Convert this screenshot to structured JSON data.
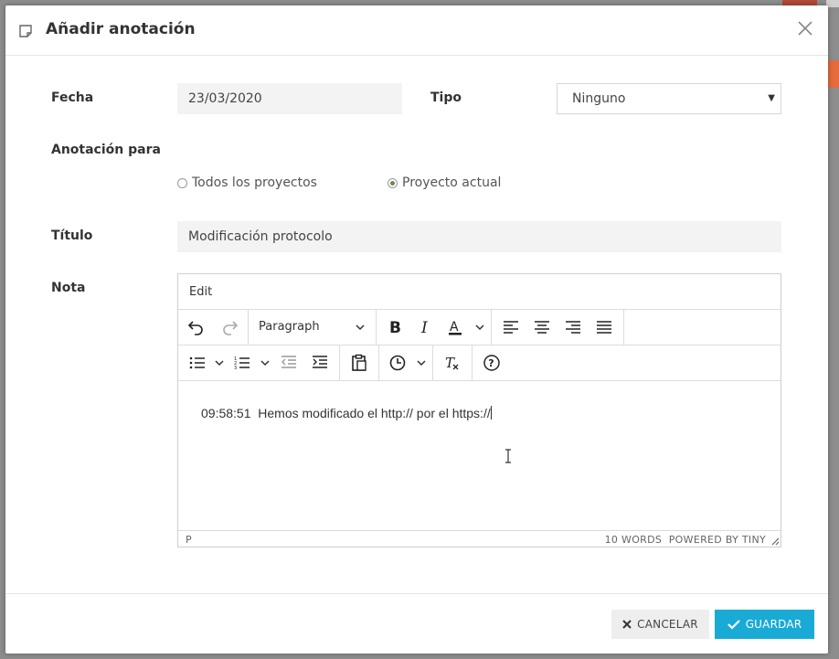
{
  "dialog": {
    "title": "Añadir anotación"
  },
  "form": {
    "fecha_label": "Fecha",
    "fecha_value": "23/03/2020",
    "tipo_label": "Tipo",
    "tipo_value": "Ninguno",
    "anotacion_label": "Anotación para",
    "radio_all": "Todos los proyectos",
    "radio_current": "Proyecto actual",
    "titulo_label": "Título",
    "titulo_value": "Modificación protocolo",
    "nota_label": "Nota"
  },
  "editor": {
    "menu_edit": "Edit",
    "block_format": "Paragraph",
    "content": "09:58:51  Hemos modificado el http:// por el https://",
    "path": "P",
    "word_count": "10 WORDS",
    "powered": "POWERED BY TINY"
  },
  "footer": {
    "cancel_label": "CANCELAR",
    "save_label": "GUARDAR"
  },
  "colors": {
    "primary": "#1aaad6",
    "cancel_bg": "#eeeeee"
  }
}
